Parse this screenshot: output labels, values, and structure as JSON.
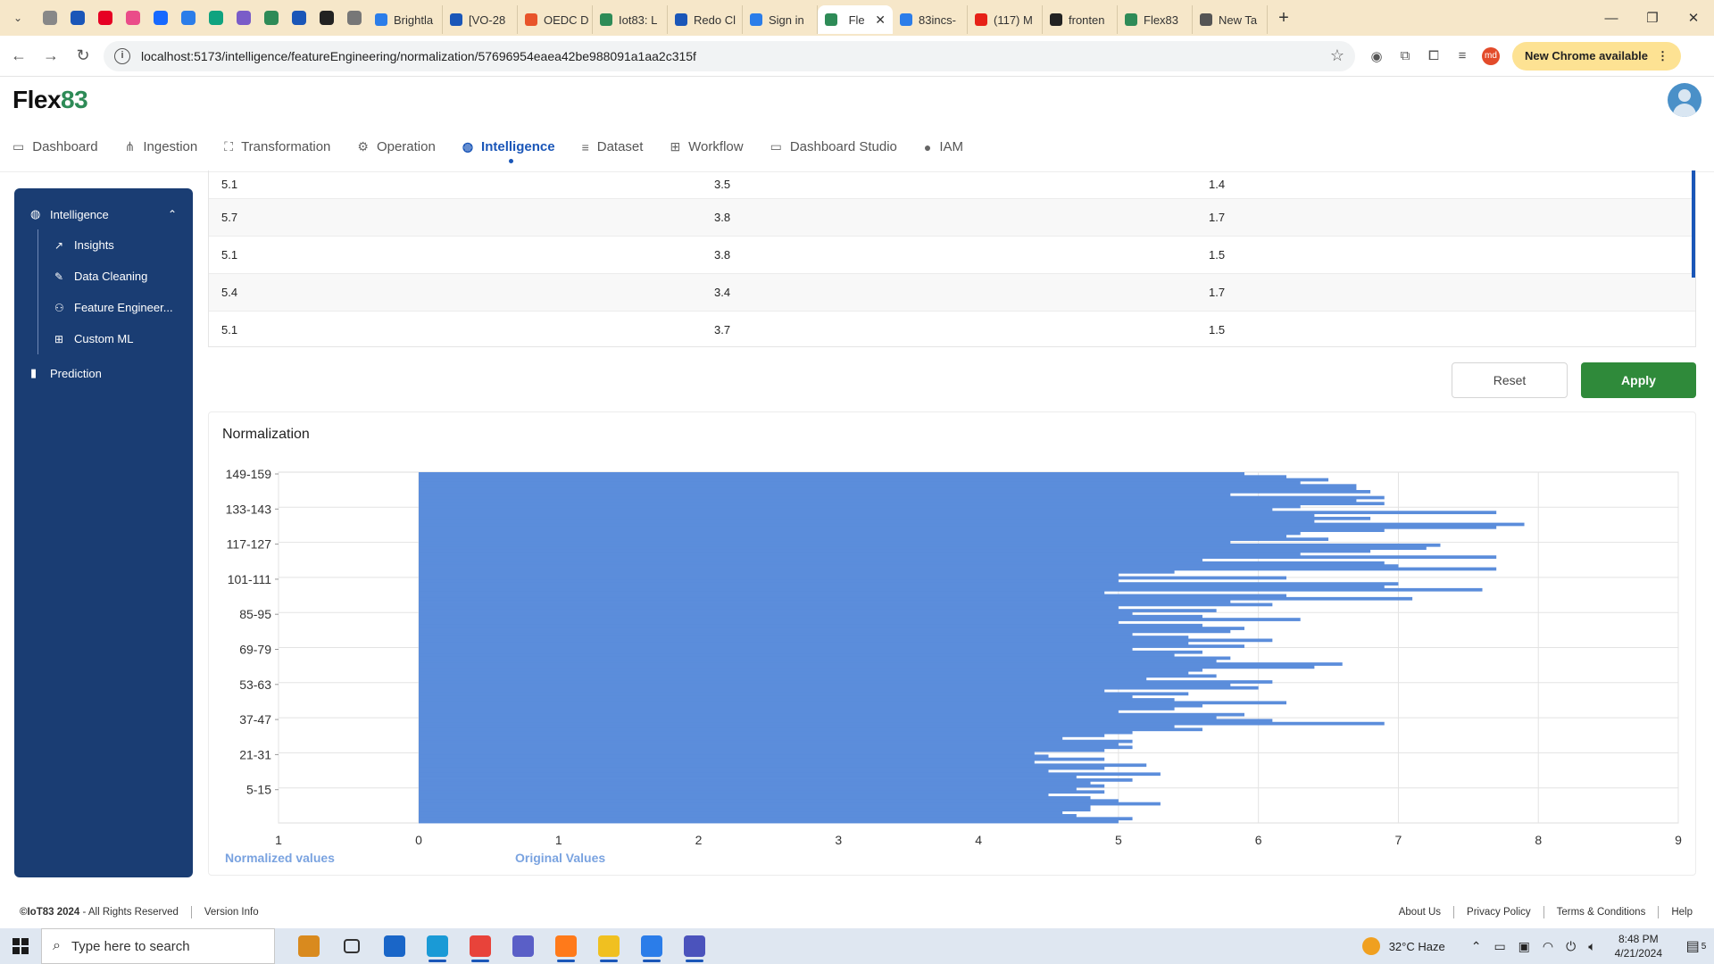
{
  "browser": {
    "tabs": [
      {
        "label": "Brightla",
        "color": "#2b7de9"
      },
      {
        "label": "[VO-28",
        "color": "#1a56b8"
      },
      {
        "label": "OEDC D",
        "color": "#e8542a"
      },
      {
        "label": "Iot83: L",
        "color": "#2e8b57"
      },
      {
        "label": "Redo Cl",
        "color": "#1a56b8"
      },
      {
        "label": "Sign in",
        "color": "#2b7de9"
      },
      {
        "label": "Fle",
        "color": "#2e8b57",
        "active": true
      },
      {
        "label": "83incs-",
        "color": "#2b7de9"
      },
      {
        "label": "(117) M",
        "color": "#e62117"
      },
      {
        "label": "fronten",
        "color": "#222222"
      },
      {
        "label": "Flex83",
        "color": "#2e8b57"
      },
      {
        "label": "New Ta",
        "color": "#555555"
      }
    ],
    "url": "localhost:5173/intelligence/featureEngineering/normalization/57696954eaea42be988091a1aa2c315f",
    "chrome_update": "New Chrome available",
    "profile_initials": "md"
  },
  "app": {
    "logo_text": "Flex",
    "logo_accent": "83",
    "nav": [
      {
        "label": "Dashboard",
        "icon": "▭"
      },
      {
        "label": "Ingestion",
        "icon": "⋔"
      },
      {
        "label": "Transformation",
        "icon": "⛶"
      },
      {
        "label": "Operation",
        "icon": "⚙"
      },
      {
        "label": "Intelligence",
        "icon": "◍",
        "active": true
      },
      {
        "label": "Dataset",
        "icon": "≡"
      },
      {
        "label": "Workflow",
        "icon": "⊞"
      },
      {
        "label": "Dashboard Studio",
        "icon": "▭"
      },
      {
        "label": "IAM",
        "icon": "●"
      }
    ]
  },
  "sidebar": {
    "group": "Intelligence",
    "items": [
      {
        "label": "Insights",
        "icon": "↗"
      },
      {
        "label": "Data Cleaning",
        "icon": "✎"
      },
      {
        "label": "Feature Engineer...",
        "icon": "⚇"
      },
      {
        "label": "Custom ML",
        "icon": "⊞"
      }
    ],
    "prediction": "Prediction"
  },
  "table": {
    "rows": [
      [
        "5.1",
        "3.5",
        "1.4"
      ],
      [
        "5.7",
        "3.8",
        "1.7"
      ],
      [
        "5.1",
        "3.8",
        "1.5"
      ],
      [
        "5.4",
        "3.4",
        "1.7"
      ],
      [
        "5.1",
        "3.7",
        "1.5"
      ]
    ]
  },
  "actions": {
    "reset": "Reset",
    "apply": "Apply"
  },
  "chart_data": {
    "type": "bar",
    "orientation": "horizontal",
    "title": "Normalization",
    "y_tick_labels": [
      "149-159",
      "133-143",
      "117-127",
      "101-111",
      "85-95",
      "69-79",
      "53-63",
      "37-47",
      "21-31",
      "5-15"
    ],
    "x_ticks": [
      1,
      0,
      1,
      2,
      3,
      4,
      5,
      6,
      7,
      8,
      9
    ],
    "x_legend": [
      "Normalized values",
      "Original Values"
    ],
    "xlim": [
      0,
      9
    ],
    "grid": true,
    "color": "#5b8ddb",
    "series": [
      {
        "name": "Original Values",
        "values": [
          5.0,
          5.1,
          4.7,
          4.6,
          4.8,
          4.8,
          5.3,
          5.0,
          4.8,
          4.5,
          4.9,
          4.7,
          4.9,
          4.8,
          5.1,
          4.7,
          5.3,
          4.5,
          4.9,
          5.2,
          4.4,
          4.9,
          4.5,
          4.4,
          4.9,
          5.1,
          5.0,
          5.1,
          4.6,
          4.9,
          5.1,
          5.6,
          5.4,
          6.9,
          6.1,
          5.7,
          5.9,
          5.0,
          5.4,
          5.6,
          6.2,
          5.4,
          5.1,
          5.5,
          4.9,
          6.0,
          5.8,
          6.1,
          5.2,
          5.7,
          5.5,
          5.6,
          6.4,
          6.6,
          5.7,
          5.8,
          5.4,
          5.6,
          5.1,
          5.9,
          5.5,
          6.1,
          5.5,
          5.1,
          5.8,
          5.9,
          5.6,
          5.0,
          6.3,
          5.6,
          5.1,
          5.7,
          5.0,
          6.1,
          5.8,
          7.1,
          6.2,
          4.9,
          7.6,
          6.9,
          7.0,
          5.0,
          6.2,
          5.0,
          5.4,
          7.7,
          7.0,
          6.9,
          5.6,
          7.7,
          6.3,
          6.8,
          7.2,
          7.3,
          5.8,
          6.5,
          6.2,
          6.3,
          6.9,
          7.7,
          7.9,
          6.4,
          6.8,
          6.4,
          7.7,
          6.1,
          6.3,
          6.9,
          6.7,
          6.9,
          5.8,
          6.8,
          6.7,
          6.7,
          6.3,
          6.5,
          6.2,
          5.9
        ]
      }
    ]
  },
  "footer": {
    "copyright": "©IoT83 2024",
    "rights": " - All Rights Reserved",
    "version": "Version Info",
    "links": [
      "About Us",
      "Privacy Policy",
      "Terms & Conditions",
      "Help"
    ]
  },
  "taskbar": {
    "search_placeholder": "Type here to search",
    "apps": [
      {
        "name": "briefcase",
        "color": "#d98a1e"
      },
      {
        "name": "task-view",
        "color": "#333333"
      },
      {
        "name": "mail",
        "color": "#1a66c8"
      },
      {
        "name": "edge",
        "color": "#1a9ad6"
      },
      {
        "name": "chrome",
        "color": "#e8433a"
      },
      {
        "name": "teams",
        "color": "#5a5fc7"
      },
      {
        "name": "firefox",
        "color": "#ff7a1a"
      },
      {
        "name": "explorer",
        "color": "#f0c020"
      },
      {
        "name": "vscode",
        "color": "#2b7de9"
      },
      {
        "name": "teams-work",
        "color": "#4b53bc"
      }
    ],
    "weather": "32°C  Haze",
    "time": "8:48 PM",
    "date": "4/21/2024",
    "notifications": "5"
  }
}
